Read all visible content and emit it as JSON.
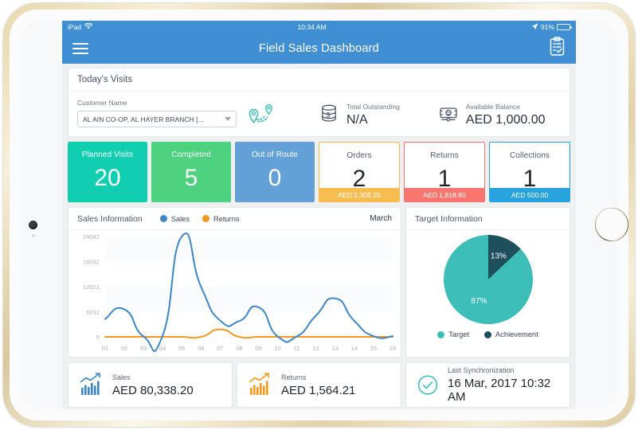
{
  "status_bar": {
    "device": "iPad",
    "wifi_icon": "wifi-icon",
    "time": "10:34 AM",
    "location_icon": "location-arrow-icon",
    "battery_percent": "91%",
    "battery_level": 91
  },
  "nav_bar": {
    "menu_icon": "hamburger-menu-icon",
    "title": "Field Sales Dashboard",
    "action_icon": "clipboard-check-icon"
  },
  "visits_panel": {
    "title": "Today's Visits",
    "customer": {
      "label": "Customer Name",
      "value": "AL AIN CO-OP,  AL HAYER BRANCH [...",
      "caret_icon": "chevron-down-icon",
      "route_icon": "route-map-pin-icon"
    },
    "total_outstanding": {
      "label": "Total Outstanding",
      "value": "N/A",
      "icon": "cash-stack-icon"
    },
    "available_balance": {
      "label": "Available Balance",
      "value": "AED 1,000.00",
      "icon": "banknote-icon"
    }
  },
  "kpi_cards": [
    {
      "label": "Planned Visits",
      "value": "20",
      "style": "solid",
      "color": "#10cfb0",
      "badge": null,
      "badge_color": null
    },
    {
      "label": "Completed",
      "value": "5",
      "style": "solid",
      "color": "#4ed17f",
      "badge": null,
      "badge_color": null
    },
    {
      "label": "Out of Route",
      "value": "0",
      "style": "solid",
      "color": "#63a0d8",
      "badge": null,
      "badge_color": null
    },
    {
      "label": "Orders",
      "value": "2",
      "style": "outline",
      "color": "#f5bb4b",
      "badge": "AED 2,308.25",
      "badge_color": "#f7bd50"
    },
    {
      "label": "Returns",
      "value": "1",
      "style": "outline",
      "color": "#f8746c",
      "badge": "AED 1,818.80",
      "badge_color": "#f9766e"
    },
    {
      "label": "Collections",
      "value": "1",
      "style": "outline",
      "color": "#29a3dc",
      "badge": "AED 500.00",
      "badge_color": "#29a3dc"
    }
  ],
  "sales_card": {
    "title": "Sales Information",
    "month": "March",
    "legend": [
      {
        "label": "Sales",
        "color": "#3d87c8"
      },
      {
        "label": "Returns",
        "color": "#f7981e"
      }
    ]
  },
  "target_card": {
    "title": "Target Information",
    "legend": [
      {
        "label": "Target",
        "color": "#3cbdb8"
      },
      {
        "label": "Achievement",
        "color": "#1d4f5c"
      }
    ]
  },
  "summary_cards": [
    {
      "label": "Sales",
      "value": "AED 80,338.20",
      "icon": "bar-chart-trend-icon",
      "color": "#3d87c8"
    },
    {
      "label": "Returns",
      "value": "AED 1,564.21",
      "icon": "bar-chart-trend-icon",
      "color": "#f7981e"
    },
    {
      "label": "Last Synchronization",
      "value": "16 Mar, 2017 10:32 AM",
      "icon": "check-circle-icon",
      "color": "#3cbdb8"
    }
  ],
  "chart_data": [
    {
      "type": "line",
      "title": "Sales Information",
      "subtitle": "March",
      "xlabel": "",
      "ylabel": "",
      "x": [
        "01",
        "02",
        "03",
        "04",
        "05",
        "06",
        "07",
        "08",
        "09",
        "10",
        "11",
        "12",
        "13",
        "14",
        "15",
        "16"
      ],
      "ytick_labels": [
        "0",
        "6011",
        "12021",
        "18032",
        "24042"
      ],
      "ytick_values": [
        0,
        6011,
        12021,
        18032,
        24042
      ],
      "ylim": [
        0,
        24042
      ],
      "grid": true,
      "legend_position": "top",
      "series": [
        {
          "name": "Sales",
          "color": "#3d87c8",
          "values": [
            4300,
            6600,
            100,
            300,
            24042,
            12021,
            3900,
            3800,
            7100,
            100,
            100,
            5100,
            9200,
            3800,
            150,
            150
          ]
        },
        {
          "name": "Returns",
          "color": "#f7981e",
          "values": [
            0,
            0,
            0,
            0,
            0,
            0,
            1800,
            0,
            0,
            0,
            0,
            0,
            0,
            0,
            0,
            0
          ]
        }
      ]
    },
    {
      "type": "pie",
      "title": "Target Information",
      "labels": [
        "Target",
        "Achievement"
      ],
      "values": [
        87,
        13
      ],
      "value_labels": [
        "87%",
        "13%"
      ],
      "colors": [
        "#3cbdb8",
        "#1d4f5c"
      ],
      "legend_position": "bottom"
    }
  ]
}
